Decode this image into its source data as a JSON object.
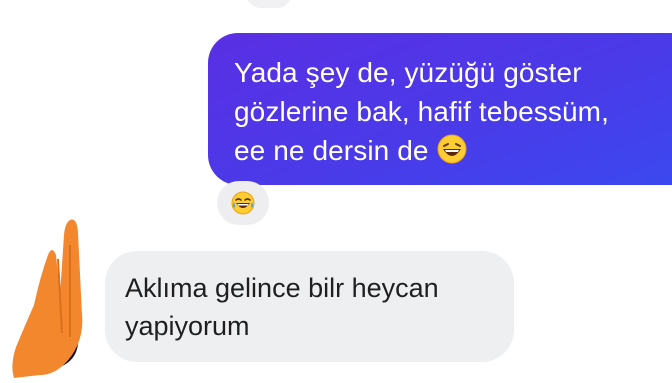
{
  "chat": {
    "outgoing": {
      "lines": [
        "Yada şey de, yüzüğü göster",
        "gözlerine bak, hafif tebessüm,",
        "ee ne dersin de"
      ],
      "emoji": "laughing-emoji",
      "gradient": [
        "#5a2fe4",
        "#3c48ef"
      ]
    },
    "reaction": {
      "emoji": "tears-of-joy-emoji"
    },
    "incoming": {
      "lines": [
        "Aklıma gelince bilr heycan",
        "yapiyorum"
      ]
    },
    "colors": {
      "incoming_bubble": "#eeeff1",
      "reaction_bg": "#eeeef0",
      "avatar": "#f2872e"
    }
  }
}
